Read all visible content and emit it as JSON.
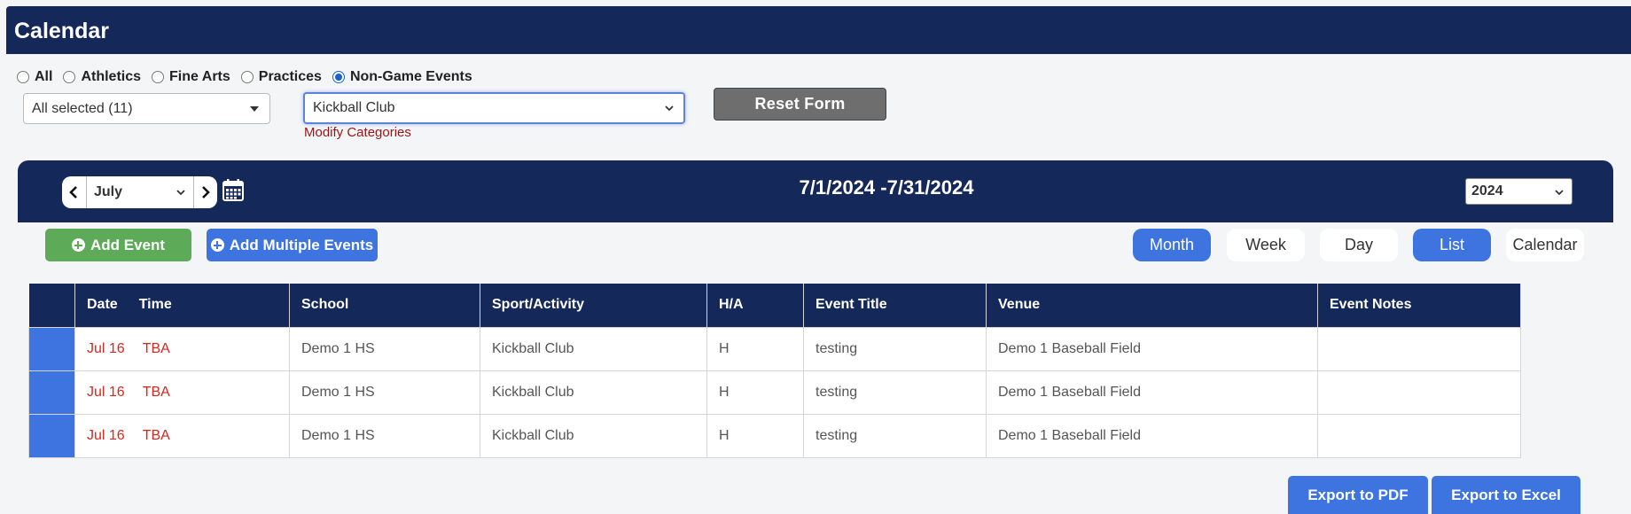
{
  "header": {
    "title": "Calendar"
  },
  "filters": {
    "radios": [
      {
        "label": "All",
        "checked": false
      },
      {
        "label": "Athletics",
        "checked": false
      },
      {
        "label": "Fine Arts",
        "checked": false
      },
      {
        "label": "Practices",
        "checked": false
      },
      {
        "label": "Non-Game Events",
        "checked": true
      }
    ],
    "school_select": "All selected (11)",
    "sport_select": "Kickball Club",
    "modify_link": "Modify Categories",
    "reset_label": "Reset Form"
  },
  "nav": {
    "month": "July",
    "date_range": "7/1/2024 -7/31/2024",
    "year": "2024"
  },
  "actions": {
    "add_event": "Add Event",
    "add_multiple": "Add Multiple Events"
  },
  "views": [
    {
      "label": "Month",
      "active": true
    },
    {
      "label": "Week",
      "active": false
    },
    {
      "label": "Day",
      "active": false
    },
    {
      "label": "List",
      "active": true
    },
    {
      "label": "Calendar",
      "active": false
    }
  ],
  "table": {
    "headers": {
      "date": "Date",
      "time": "Time",
      "school": "School",
      "sport": "Sport/Activity",
      "ha": "H/A",
      "title": "Event Title",
      "venue": "Venue",
      "notes": "Event Notes"
    },
    "rows": [
      {
        "date": "Jul 16",
        "time": "TBA",
        "school": "Demo 1 HS",
        "sport": "Kickball Club",
        "ha": "H",
        "title": "testing",
        "venue": "Demo 1 Baseball Field",
        "notes": ""
      },
      {
        "date": "Jul 16",
        "time": "TBA",
        "school": "Demo 1 HS",
        "sport": "Kickball Club",
        "ha": "H",
        "title": "testing",
        "venue": "Demo 1 Baseball Field",
        "notes": ""
      },
      {
        "date": "Jul 16",
        "time": "TBA",
        "school": "Demo 1 HS",
        "sport": "Kickball Club",
        "ha": "H",
        "title": "testing",
        "venue": "Demo 1 Baseball Field",
        "notes": ""
      }
    ]
  },
  "export": {
    "pdf": "Export to PDF",
    "excel": "Export to Excel"
  },
  "colors": {
    "navy": "#15285a",
    "accent_blue": "#3e74e0",
    "green": "#5dab58",
    "date_red": "#d9261c",
    "link_red": "#9a1414"
  },
  "icons": [
    "chevron-left-icon",
    "chevron-right-icon",
    "chevron-down-icon",
    "calendar-icon",
    "plus-circle-icon"
  ]
}
